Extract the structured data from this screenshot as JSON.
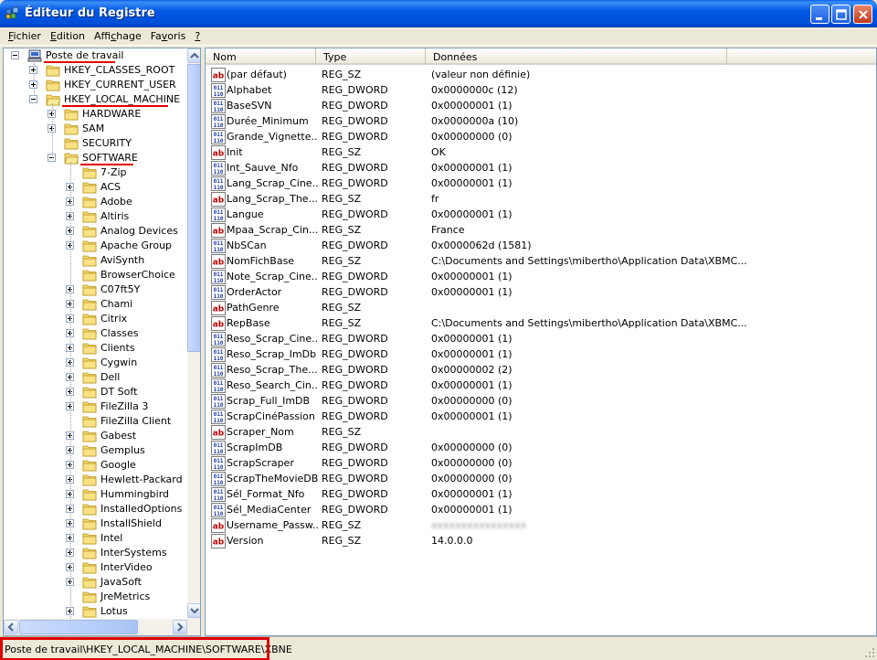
{
  "window": {
    "title": "Éditeur du Registre",
    "minimize_label": "Réduire",
    "maximize_label": "Agrandir",
    "close_label": "Fermer"
  },
  "menu": [
    {
      "label": "Fichier",
      "mnemonic": "F"
    },
    {
      "label": "Edition",
      "mnemonic": "E"
    },
    {
      "label": "Affichage",
      "mnemonic": "c"
    },
    {
      "label": "Favoris",
      "mnemonic": "v"
    },
    {
      "label": "?",
      "mnemonic": "?"
    }
  ],
  "tree": {
    "root": "Poste de travail",
    "hives": [
      {
        "label": "HKEY_CLASSES_ROOT",
        "expanded": false
      },
      {
        "label": "HKEY_CURRENT_USER",
        "expanded": false
      },
      {
        "label": "HKEY_LOCAL_MACHINE",
        "expanded": true
      }
    ],
    "hklm_children": [
      {
        "label": "HARDWARE",
        "has_children": true
      },
      {
        "label": "SAM",
        "has_children": true
      },
      {
        "label": "SECURITY",
        "has_children": false
      },
      {
        "label": "SOFTWARE",
        "has_children": true,
        "expanded": true
      }
    ],
    "software_children": [
      {
        "label": "7-Zip",
        "has_children": false
      },
      {
        "label": "ACS",
        "has_children": true
      },
      {
        "label": "Adobe",
        "has_children": true
      },
      {
        "label": "Altiris",
        "has_children": true
      },
      {
        "label": "Analog Devices",
        "has_children": true
      },
      {
        "label": "Apache Group",
        "has_children": true
      },
      {
        "label": "AviSynth",
        "has_children": false
      },
      {
        "label": "BrowserChoice",
        "has_children": false
      },
      {
        "label": "C07ft5Y",
        "has_children": true
      },
      {
        "label": "Chami",
        "has_children": true
      },
      {
        "label": "Citrix",
        "has_children": true
      },
      {
        "label": "Classes",
        "has_children": true
      },
      {
        "label": "Clients",
        "has_children": true
      },
      {
        "label": "Cygwin",
        "has_children": true
      },
      {
        "label": "Dell",
        "has_children": true
      },
      {
        "label": "DT Soft",
        "has_children": true
      },
      {
        "label": "FileZilla 3",
        "has_children": true
      },
      {
        "label": "FileZilla Client",
        "has_children": false
      },
      {
        "label": "Gabest",
        "has_children": true
      },
      {
        "label": "Gemplus",
        "has_children": true
      },
      {
        "label": "Google",
        "has_children": true
      },
      {
        "label": "Hewlett-Packard",
        "has_children": true
      },
      {
        "label": "Hummingbird",
        "has_children": true
      },
      {
        "label": "InstalledOptions",
        "has_children": true
      },
      {
        "label": "InstallShield",
        "has_children": true
      },
      {
        "label": "Intel",
        "has_children": true
      },
      {
        "label": "InterSystems",
        "has_children": true
      },
      {
        "label": "InterVideo",
        "has_children": true
      },
      {
        "label": "JavaSoft",
        "has_children": true
      },
      {
        "label": "JreMetrics",
        "has_children": false
      },
      {
        "label": "Lotus",
        "has_children": true
      }
    ]
  },
  "list": {
    "columns": [
      "Nom",
      "Type",
      "Données"
    ],
    "rows": [
      {
        "icon": "string",
        "name": "(par défaut)",
        "type": "REG_SZ",
        "data": "(valeur non définie)"
      },
      {
        "icon": "binary",
        "name": "Alphabet",
        "type": "REG_DWORD",
        "data": "0x0000000c (12)"
      },
      {
        "icon": "binary",
        "name": "BaseSVN",
        "type": "REG_DWORD",
        "data": "0x00000001 (1)"
      },
      {
        "icon": "binary",
        "name": "Durée_Minimum",
        "type": "REG_DWORD",
        "data": "0x0000000a (10)"
      },
      {
        "icon": "binary",
        "name": "Grande_Vignette...",
        "type": "REG_DWORD",
        "data": "0x00000000 (0)"
      },
      {
        "icon": "string",
        "name": "Init",
        "type": "REG_SZ",
        "data": "OK"
      },
      {
        "icon": "binary",
        "name": "Int_Sauve_Nfo",
        "type": "REG_DWORD",
        "data": "0x00000001 (1)"
      },
      {
        "icon": "binary",
        "name": "Lang_Scrap_Cine...",
        "type": "REG_DWORD",
        "data": "0x00000001 (1)"
      },
      {
        "icon": "string",
        "name": "Lang_Scrap_The...",
        "type": "REG_SZ",
        "data": "fr"
      },
      {
        "icon": "binary",
        "name": "Langue",
        "type": "REG_DWORD",
        "data": "0x00000001 (1)"
      },
      {
        "icon": "string",
        "name": "Mpaa_Scrap_Cin...",
        "type": "REG_SZ",
        "data": "France"
      },
      {
        "icon": "binary",
        "name": "NbSCan",
        "type": "REG_DWORD",
        "data": "0x0000062d (1581)"
      },
      {
        "icon": "string",
        "name": "NomFichBase",
        "type": "REG_SZ",
        "data": "C:\\Documents and Settings\\mibertho\\Application Data\\XBMC..."
      },
      {
        "icon": "binary",
        "name": "Note_Scrap_Cine...",
        "type": "REG_DWORD",
        "data": "0x00000001 (1)"
      },
      {
        "icon": "binary",
        "name": "OrderActor",
        "type": "REG_DWORD",
        "data": "0x00000001 (1)"
      },
      {
        "icon": "string",
        "name": "PathGenre",
        "type": "REG_SZ",
        "data": ""
      },
      {
        "icon": "string",
        "name": "RepBase",
        "type": "REG_SZ",
        "data": "C:\\Documents and Settings\\mibertho\\Application Data\\XBMC..."
      },
      {
        "icon": "binary",
        "name": "Reso_Scrap_Cine...",
        "type": "REG_DWORD",
        "data": "0x00000001 (1)"
      },
      {
        "icon": "binary",
        "name": "Reso_Scrap_ImDb",
        "type": "REG_DWORD",
        "data": "0x00000001 (1)"
      },
      {
        "icon": "binary",
        "name": "Reso_Scrap_The...",
        "type": "REG_DWORD",
        "data": "0x00000002 (2)"
      },
      {
        "icon": "binary",
        "name": "Reso_Search_Cin...",
        "type": "REG_DWORD",
        "data": "0x00000001 (1)"
      },
      {
        "icon": "binary",
        "name": "Scrap_Full_ImDB",
        "type": "REG_DWORD",
        "data": "0x00000000 (0)"
      },
      {
        "icon": "binary",
        "name": "ScrapCinéPassion",
        "type": "REG_DWORD",
        "data": "0x00000001 (1)"
      },
      {
        "icon": "string",
        "name": "Scraper_Nom",
        "type": "REG_SZ",
        "data": ""
      },
      {
        "icon": "binary",
        "name": "ScrapImDB",
        "type": "REG_DWORD",
        "data": "0x00000000 (0)"
      },
      {
        "icon": "binary",
        "name": "ScrapScraper",
        "type": "REG_DWORD",
        "data": "0x00000000 (0)"
      },
      {
        "icon": "binary",
        "name": "ScrapTheMovieDB",
        "type": "REG_DWORD",
        "data": "0x00000000 (0)"
      },
      {
        "icon": "binary",
        "name": "Sél_Format_Nfo",
        "type": "REG_DWORD",
        "data": "0x00000001 (1)"
      },
      {
        "icon": "binary",
        "name": "Sél_MediaCenter",
        "type": "REG_DWORD",
        "data": "0x00000001 (1)"
      },
      {
        "icon": "string",
        "name": "Username_Passw...",
        "type": "REG_SZ",
        "data": "xxxxxxxxxxxxxxxx",
        "blurred": true
      },
      {
        "icon": "string",
        "name": "Version",
        "type": "REG_SZ",
        "data": "14.0.0.0"
      }
    ]
  },
  "status": {
    "path": "Poste de travail\\HKEY_LOCAL_MACHINE\\SOFTWARE\\XBNE"
  },
  "colors": {
    "title_bar": "#0058e6",
    "highlight": "#e00000",
    "string_icon": "#c00000",
    "binary_icon": "#1c3aa8"
  }
}
